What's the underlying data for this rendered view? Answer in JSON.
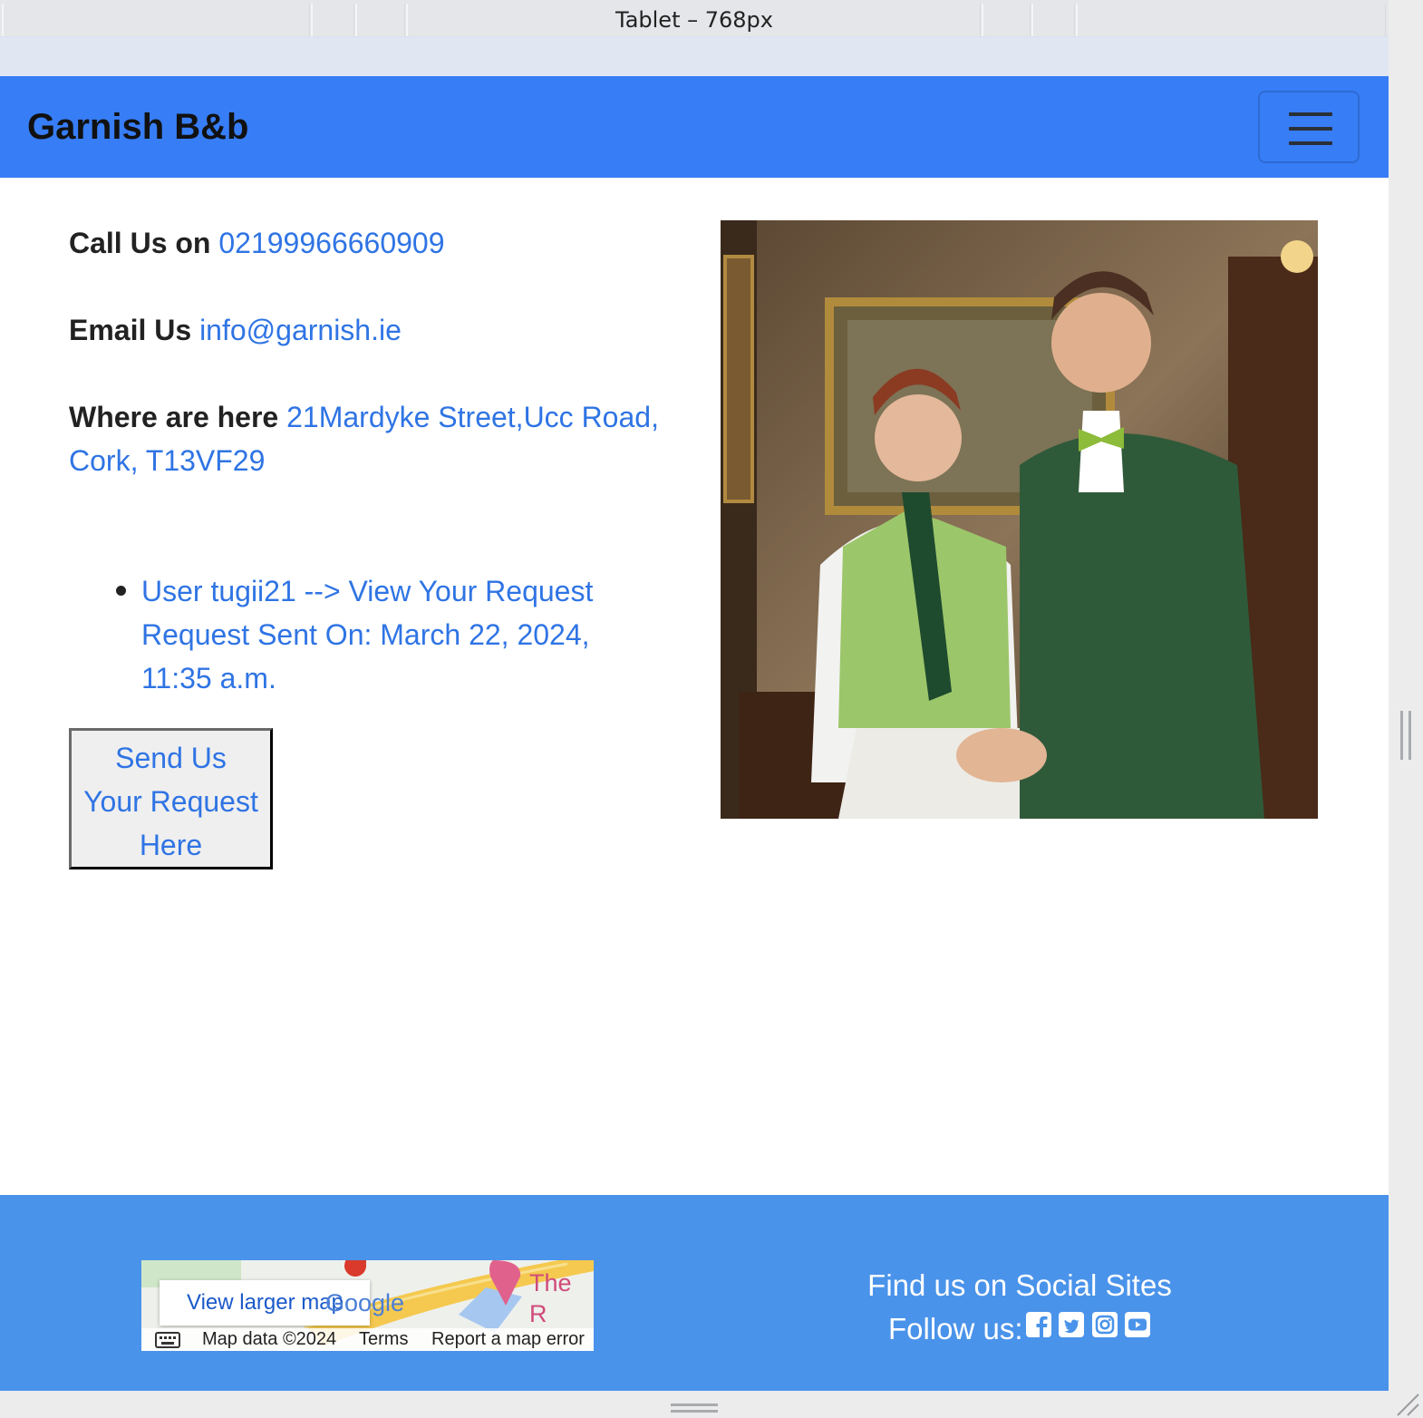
{
  "device_bar": {
    "label": "Tablet – 768px"
  },
  "navbar": {
    "brand": "Garnish B&b",
    "toggler_icon": "hamburger-menu-icon"
  },
  "contact": {
    "call_label": "Call Us on",
    "phone": "02199966660909",
    "email_label": "Email Us",
    "email": "info@garnish.ie",
    "address_label": "Where are here",
    "address_line1": "21Mardyke Street,Ucc Road,",
    "address_line2": "Cork, T13VF29"
  },
  "requests": {
    "items": [
      {
        "line1": "User tugii21 --> View Your Request",
        "line2": "Request Sent On: March 22, 2024,",
        "line3": "11:35 a.m."
      }
    ]
  },
  "send_button": {
    "line1": "Send Us",
    "line2": "Your Request",
    "line3": "Here"
  },
  "footer": {
    "map": {
      "view_larger": "View larger map",
      "map_data": "Map data ©2024",
      "terms": "Terms",
      "report": "Report a map error",
      "place_label": "The R",
      "google_logo": "Google"
    },
    "social_title": "Find us on Social Sites",
    "follow_label": "Follow us:",
    "icons": [
      "facebook-icon",
      "twitter-icon",
      "instagram-icon",
      "youtube-icon"
    ]
  },
  "colors": {
    "navbar": "#377df6",
    "footer": "#4a93ea",
    "link": "#2f74e4"
  }
}
